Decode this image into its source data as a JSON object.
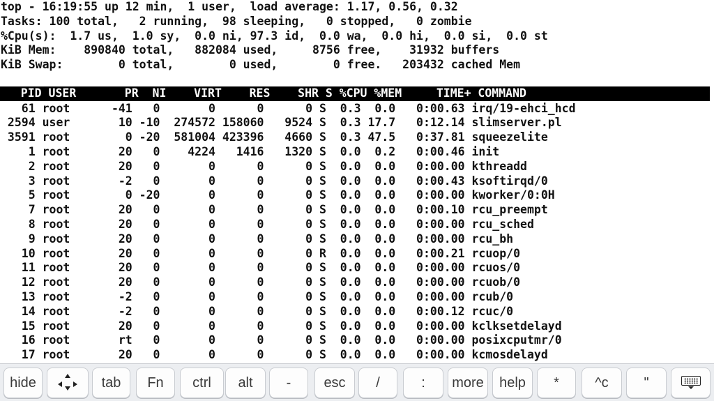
{
  "summary": [
    "top - 16:19:55 up 12 min,  1 user,  load average: 1.17, 0.56, 0.32",
    "Tasks: 100 total,   2 running,  98 sleeping,   0 stopped,   0 zombie",
    "%Cpu(s):  1.7 us,  1.0 sy,  0.0 ni, 97.3 id,  0.0 wa,  0.0 hi,  0.0 si,  0.0 st",
    "KiB Mem:    890840 total,   882084 used,     8756 free,    31932 buffers",
    "KiB Swap:        0 total,        0 used,        0 free.   203432 cached Mem"
  ],
  "columns": [
    "PID",
    "USER",
    "PR",
    "NI",
    "VIRT",
    "RES",
    "SHR",
    "S",
    "%CPU",
    "%MEM",
    "TIME+",
    "COMMAND"
  ],
  "processes": [
    {
      "pid": "61",
      "user": "root",
      "pr": "-41",
      "ni": "0",
      "virt": "0",
      "res": "0",
      "shr": "0",
      "s": "S",
      "cpu": "0.3",
      "mem": "0.0",
      "time": "0:00.63",
      "command": "irq/19-ehci_hcd"
    },
    {
      "pid": "2594",
      "user": "user",
      "pr": "10",
      "ni": "-10",
      "virt": "274572",
      "res": "158060",
      "shr": "9524",
      "s": "S",
      "cpu": "0.3",
      "mem": "17.7",
      "time": "0:12.14",
      "command": "slimserver.pl"
    },
    {
      "pid": "3591",
      "user": "root",
      "pr": "0",
      "ni": "-20",
      "virt": "581004",
      "res": "423396",
      "shr": "4660",
      "s": "S",
      "cpu": "0.3",
      "mem": "47.5",
      "time": "0:37.81",
      "command": "squeezelite"
    },
    {
      "pid": "1",
      "user": "root",
      "pr": "20",
      "ni": "0",
      "virt": "4224",
      "res": "1416",
      "shr": "1320",
      "s": "S",
      "cpu": "0.0",
      "mem": "0.2",
      "time": "0:00.46",
      "command": "init"
    },
    {
      "pid": "2",
      "user": "root",
      "pr": "20",
      "ni": "0",
      "virt": "0",
      "res": "0",
      "shr": "0",
      "s": "S",
      "cpu": "0.0",
      "mem": "0.0",
      "time": "0:00.00",
      "command": "kthreadd"
    },
    {
      "pid": "3",
      "user": "root",
      "pr": "-2",
      "ni": "0",
      "virt": "0",
      "res": "0",
      "shr": "0",
      "s": "S",
      "cpu": "0.0",
      "mem": "0.0",
      "time": "0:00.43",
      "command": "ksoftirqd/0"
    },
    {
      "pid": "5",
      "user": "root",
      "pr": "0",
      "ni": "-20",
      "virt": "0",
      "res": "0",
      "shr": "0",
      "s": "S",
      "cpu": "0.0",
      "mem": "0.0",
      "time": "0:00.00",
      "command": "kworker/0:0H"
    },
    {
      "pid": "7",
      "user": "root",
      "pr": "20",
      "ni": "0",
      "virt": "0",
      "res": "0",
      "shr": "0",
      "s": "S",
      "cpu": "0.0",
      "mem": "0.0",
      "time": "0:00.10",
      "command": "rcu_preempt"
    },
    {
      "pid": "8",
      "user": "root",
      "pr": "20",
      "ni": "0",
      "virt": "0",
      "res": "0",
      "shr": "0",
      "s": "S",
      "cpu": "0.0",
      "mem": "0.0",
      "time": "0:00.00",
      "command": "rcu_sched"
    },
    {
      "pid": "9",
      "user": "root",
      "pr": "20",
      "ni": "0",
      "virt": "0",
      "res": "0",
      "shr": "0",
      "s": "S",
      "cpu": "0.0",
      "mem": "0.0",
      "time": "0:00.00",
      "command": "rcu_bh"
    },
    {
      "pid": "10",
      "user": "root",
      "pr": "20",
      "ni": "0",
      "virt": "0",
      "res": "0",
      "shr": "0",
      "s": "R",
      "cpu": "0.0",
      "mem": "0.0",
      "time": "0:00.21",
      "command": "rcuop/0"
    },
    {
      "pid": "11",
      "user": "root",
      "pr": "20",
      "ni": "0",
      "virt": "0",
      "res": "0",
      "shr": "0",
      "s": "S",
      "cpu": "0.0",
      "mem": "0.0",
      "time": "0:00.00",
      "command": "rcuos/0"
    },
    {
      "pid": "12",
      "user": "root",
      "pr": "20",
      "ni": "0",
      "virt": "0",
      "res": "0",
      "shr": "0",
      "s": "S",
      "cpu": "0.0",
      "mem": "0.0",
      "time": "0:00.00",
      "command": "rcuob/0"
    },
    {
      "pid": "13",
      "user": "root",
      "pr": "-2",
      "ni": "0",
      "virt": "0",
      "res": "0",
      "shr": "0",
      "s": "S",
      "cpu": "0.0",
      "mem": "0.0",
      "time": "0:00.00",
      "command": "rcub/0"
    },
    {
      "pid": "14",
      "user": "root",
      "pr": "-2",
      "ni": "0",
      "virt": "0",
      "res": "0",
      "shr": "0",
      "s": "S",
      "cpu": "0.0",
      "mem": "0.0",
      "time": "0:00.12",
      "command": "rcuc/0"
    },
    {
      "pid": "15",
      "user": "root",
      "pr": "20",
      "ni": "0",
      "virt": "0",
      "res": "0",
      "shr": "0",
      "s": "S",
      "cpu": "0.0",
      "mem": "0.0",
      "time": "0:00.00",
      "command": "kclksetdelayd"
    },
    {
      "pid": "16",
      "user": "root",
      "pr": "rt",
      "ni": "0",
      "virt": "0",
      "res": "0",
      "shr": "0",
      "s": "S",
      "cpu": "0.0",
      "mem": "0.0",
      "time": "0:00.00",
      "command": "posixcputmr/0"
    },
    {
      "pid": "17",
      "user": "root",
      "pr": "20",
      "ni": "0",
      "virt": "0",
      "res": "0",
      "shr": "0",
      "s": "S",
      "cpu": "0.0",
      "mem": "0.0",
      "time": "0:00.00",
      "command": "kcmosdelayd"
    }
  ],
  "keyboard": {
    "keys": [
      {
        "name": "hide-key",
        "label": "hide"
      },
      {
        "name": "arrows-key",
        "icon": "arrow-keys-icon"
      },
      {
        "name": "tab-key",
        "label": "tab"
      },
      {
        "name": "fn-key",
        "label": "Fn"
      },
      {
        "name": "ctrl-key",
        "label": "ctrl"
      },
      {
        "name": "alt-key",
        "label": "alt"
      },
      {
        "name": "dash-key",
        "label": "-"
      },
      {
        "name": "esc-key",
        "label": "esc"
      },
      {
        "name": "slash-key",
        "label": "/"
      },
      {
        "name": "colon-key",
        "label": ":"
      },
      {
        "name": "more-key",
        "label": "more"
      },
      {
        "name": "help-key",
        "label": "help"
      },
      {
        "name": "star-key",
        "label": "*"
      },
      {
        "name": "ctrl-c-key",
        "label": "^c"
      },
      {
        "name": "quote-key",
        "label": "\""
      },
      {
        "name": "keyboard-toggle-key",
        "icon": "keyboard-icon"
      }
    ]
  },
  "colors": {
    "terminal_bg": "#ffffff",
    "terminal_fg": "#111111",
    "header_bg": "#000000",
    "header_fg": "#ffffff",
    "keybar_bg": "#eceef1"
  }
}
